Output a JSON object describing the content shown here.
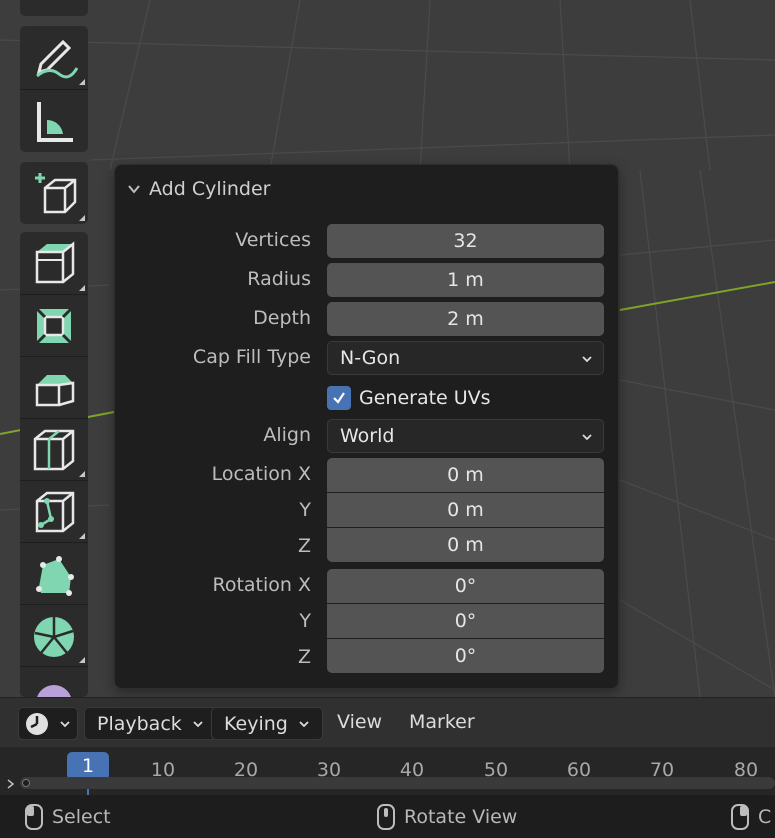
{
  "operator_panel": {
    "title": "Add Cylinder",
    "vertices": {
      "label": "Vertices",
      "value": "32"
    },
    "radius": {
      "label": "Radius",
      "value": "1 m"
    },
    "depth": {
      "label": "Depth",
      "value": "2 m"
    },
    "cap_fill_type": {
      "label": "Cap Fill Type",
      "value": "N-Gon"
    },
    "generate_uvs": {
      "label": "Generate UVs",
      "checked": true
    },
    "align": {
      "label": "Align",
      "value": "World"
    },
    "location": {
      "label": "Location X",
      "x": "0 m",
      "y_label": "Y",
      "y": "0 m",
      "z_label": "Z",
      "z": "0 m"
    },
    "rotation": {
      "label": "Rotation X",
      "x": "0°",
      "y_label": "Y",
      "y": "0°",
      "z_label": "Z",
      "z": "0°"
    }
  },
  "toolbar": {
    "tools": [
      "annotate-icon",
      "measure-icon",
      "add-cube-icon",
      "extrude-region-icon",
      "inset-faces-icon",
      "bevel-icon",
      "loop-cut-icon",
      "knife-icon",
      "poly-build-icon",
      "spin-icon",
      "smooth-icon"
    ]
  },
  "timeline": {
    "menus": {
      "playback": "Playback",
      "keying": "Keying",
      "view": "View",
      "marker": "Marker"
    },
    "current_frame": "1",
    "frame_labels": [
      "10",
      "20",
      "30",
      "40",
      "50",
      "60",
      "70",
      "80"
    ]
  },
  "statusbar": {
    "select": "Select",
    "rotate_view": "Rotate View",
    "third": "C"
  },
  "colors": {
    "accent": "#4772b3",
    "viewport_bg": "#3d3d3d",
    "tool_icon": "#7fd6b0",
    "x_axis": "#7fa42a"
  }
}
